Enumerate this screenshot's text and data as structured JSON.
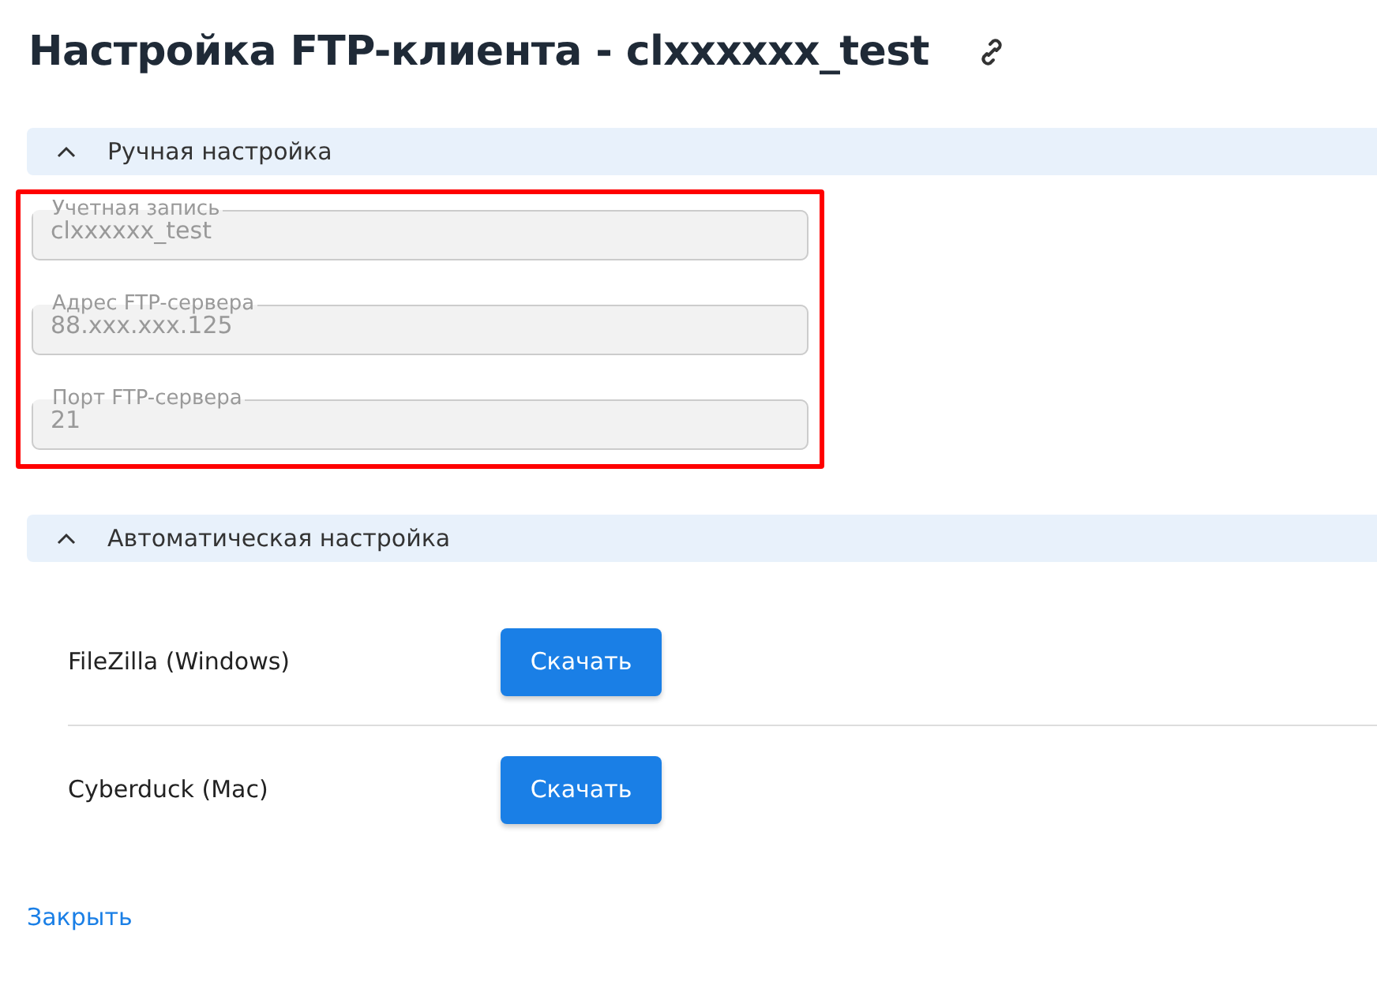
{
  "title": "Настройка FTP-клиента - clxxxxxx_test",
  "sections": [
    {
      "kind": "fields",
      "title": "Ручная настройка",
      "expanded": true,
      "highlighted": true,
      "fields": [
        {
          "label": "Учетная запись",
          "value": "clxxxxxx_test",
          "disabled": true
        },
        {
          "label": "Адрес FTP-сервера",
          "value": "88.xxx.xxx.125",
          "disabled": true
        },
        {
          "label": "Порт FTP-сервера",
          "value": "21",
          "disabled": true
        }
      ]
    },
    {
      "kind": "downloads",
      "title": "Автоматическая настройка",
      "expanded": true,
      "rows": [
        {
          "name": "FileZilla (Windows)",
          "button": "Скачать"
        },
        {
          "name": "Cyberduck (Mac)",
          "button": "Скачать"
        }
      ]
    }
  ],
  "close_link": "Закрыть"
}
